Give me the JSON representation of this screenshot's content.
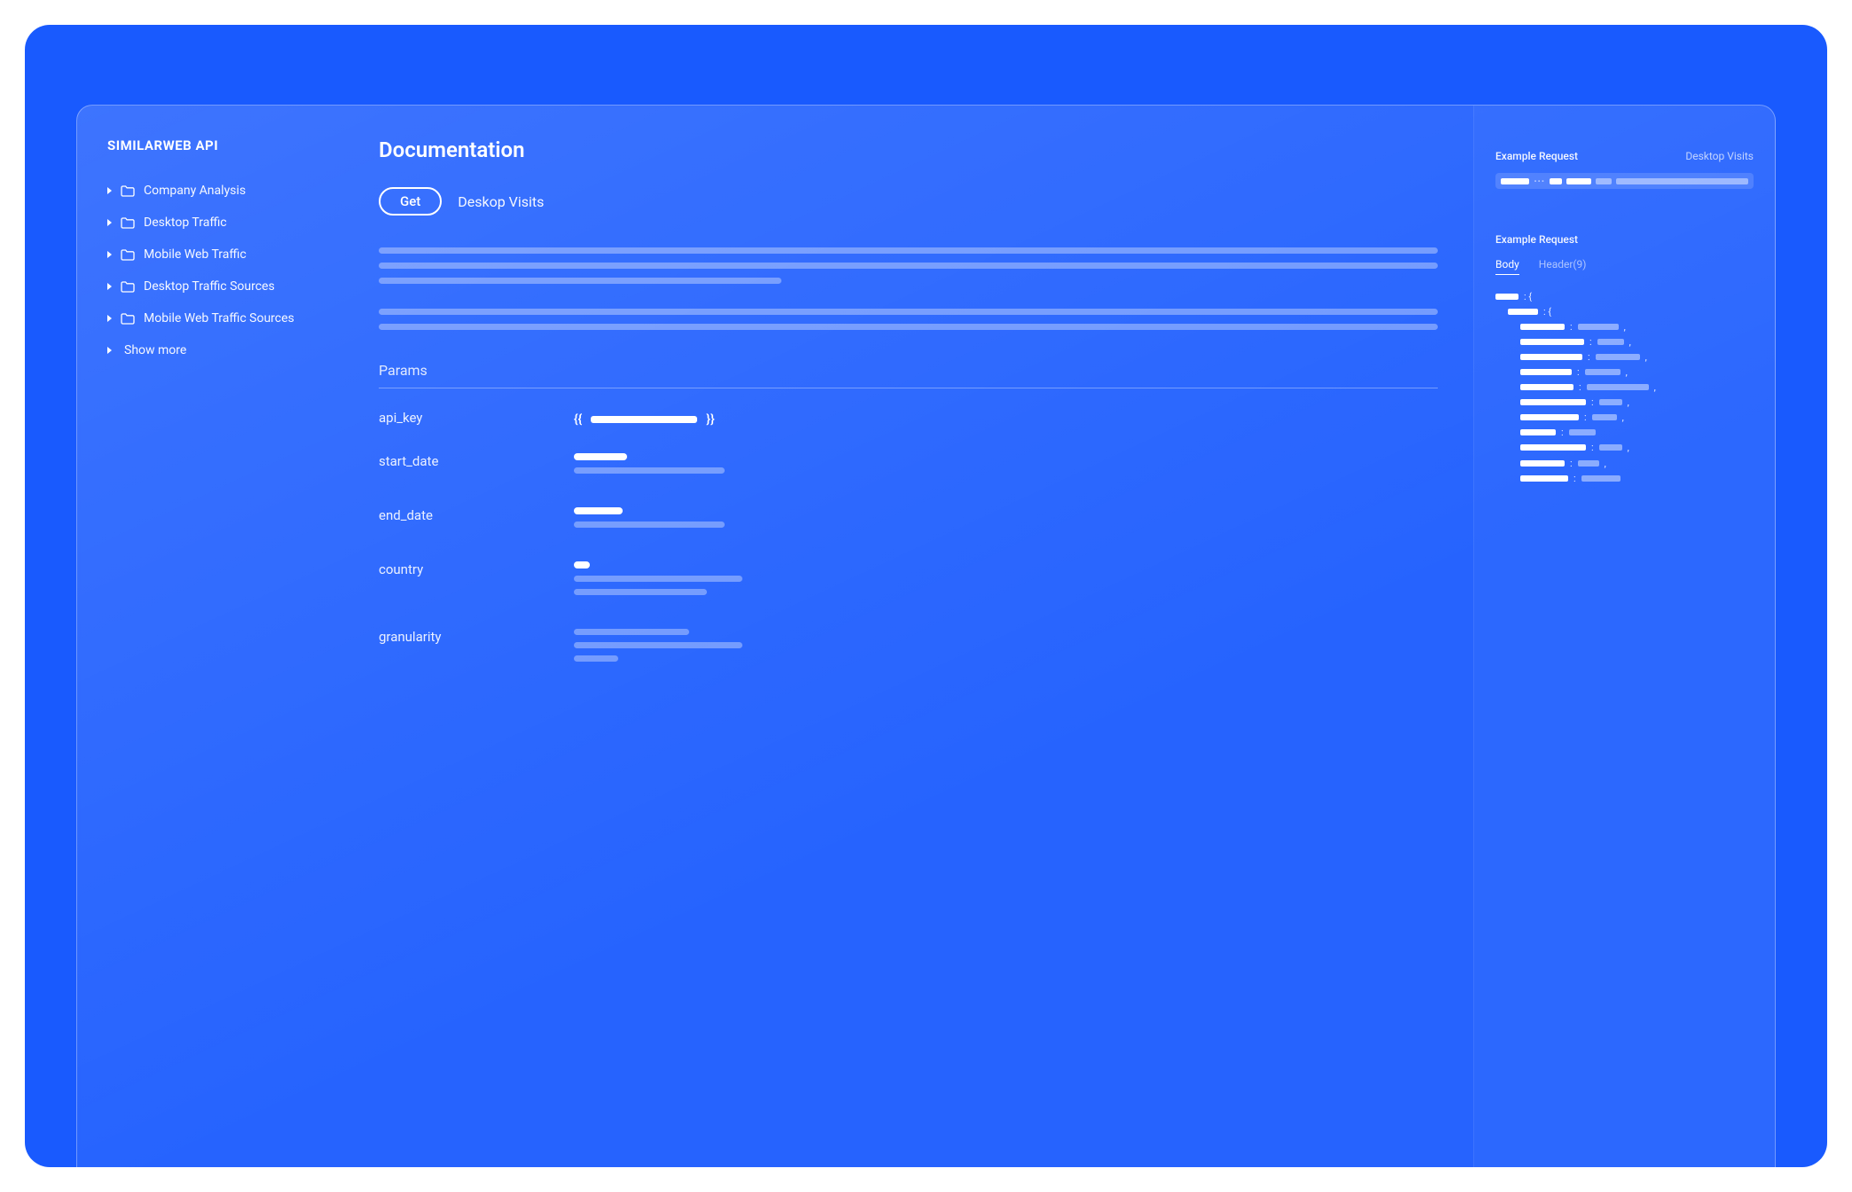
{
  "sidebar": {
    "title": "SIMILARWEB API",
    "items": [
      {
        "label": "Company Analysis"
      },
      {
        "label": "Desktop Traffic"
      },
      {
        "label": "Mobile Web Traffic"
      },
      {
        "label": "Desktop Traffic Sources"
      },
      {
        "label": "Mobile Web Traffic Sources"
      }
    ],
    "show_more": "Show more"
  },
  "main": {
    "title": "Documentation",
    "method": "Get",
    "endpoint": "Deskop Visits",
    "params_title": "Params",
    "params": [
      {
        "name": "api_key"
      },
      {
        "name": "start_date"
      },
      {
        "name": "end_date"
      },
      {
        "name": "country"
      },
      {
        "name": "granularity"
      }
    ],
    "api_key_placeholder_open": "{{",
    "api_key_placeholder_close": "}}"
  },
  "right": {
    "example_request_label": "Example Request",
    "endpoint_label": "Desktop Visits",
    "response_label": "Example Request",
    "tabs": {
      "body": "Body",
      "header": "Header(9)"
    }
  }
}
